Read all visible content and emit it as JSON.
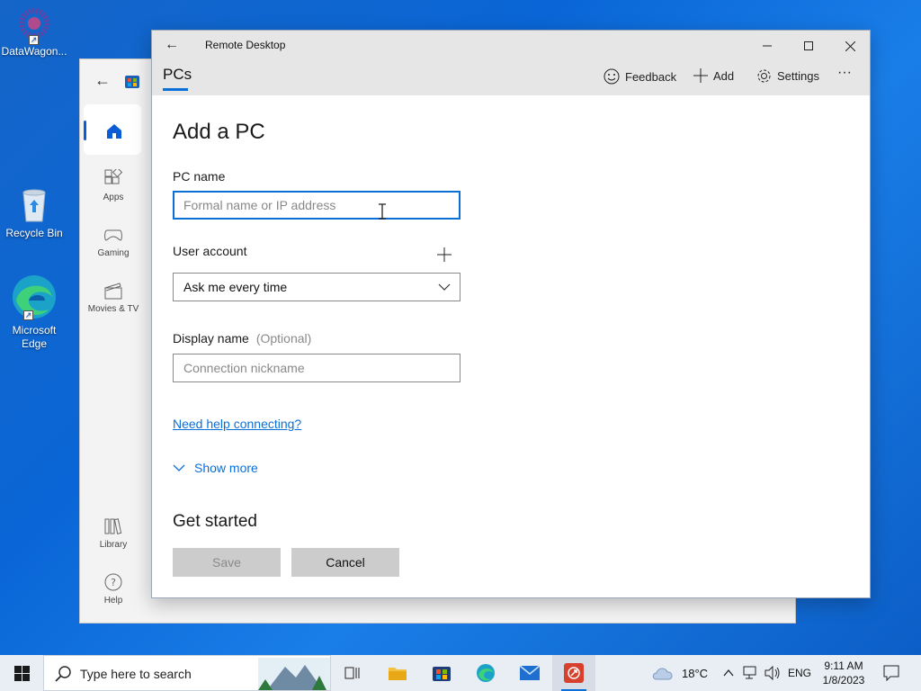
{
  "desktop": {
    "icons": [
      {
        "label": "DataWagon..."
      },
      {
        "label": "Recycle Bin"
      },
      {
        "label": "Microsoft Edge"
      }
    ]
  },
  "store": {
    "nav": [
      {
        "label": "Apps"
      },
      {
        "label": "Gaming"
      },
      {
        "label": "Movies & TV"
      },
      {
        "label": "Library"
      },
      {
        "label": "Help"
      }
    ]
  },
  "window": {
    "title": "Remote Desktop",
    "tab": "PCs",
    "feedback": "Feedback",
    "add": "Add",
    "settings": "Settings",
    "more": "···"
  },
  "form": {
    "heading": "Add a PC",
    "pc_name_label": "PC name",
    "pc_name_placeholder": "Formal name or IP address",
    "pc_name_value": "",
    "user_account_label": "User account",
    "user_account_value": "Ask me every time",
    "display_name_label": "Display name",
    "display_name_optional": "(Optional)",
    "display_name_placeholder": "Connection nickname",
    "help_link": "Need help connecting?",
    "show_more": "Show more",
    "get_started": "Get started",
    "save": "Save",
    "cancel": "Cancel"
  },
  "taskbar": {
    "search_placeholder": "Type here to search",
    "weather": "18°C",
    "language": "ENG",
    "time": "9:11 AM",
    "date": "1/8/2023"
  },
  "colors": {
    "accent": "#0b6fd8",
    "desktop": "#0a66d6"
  }
}
